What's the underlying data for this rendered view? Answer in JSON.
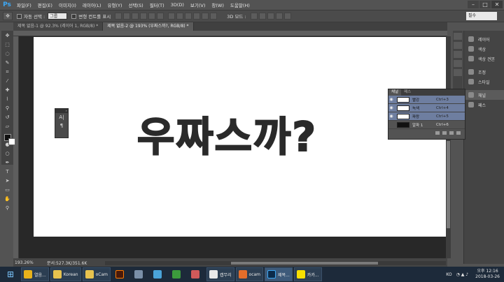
{
  "menu": {
    "logo": "Ps",
    "items": [
      "파일(F)",
      "편집(E)",
      "이미지(I)",
      "레이어(L)",
      "유형(Y)",
      "선택(S)",
      "필터(T)",
      "3D(D)",
      "보기(V)",
      "창(W)",
      "도움말(H)"
    ]
  },
  "window_controls": {
    "minimize": "–",
    "maximize": "□",
    "close": "✕"
  },
  "options": {
    "auto_select_label": "자동 선택 :",
    "auto_select_value": "그룹",
    "transform_label": "변형 컨트롤 표시",
    "mode_3d_label": "3D 모드 :",
    "workspace": "필수"
  },
  "tabs": [
    {
      "label": "제목 없음-1 @ 92.3% (레이어 1, RGB/8) *",
      "close": "×"
    },
    {
      "label": "제목 없음-2 @ 193% (우짜스까?, RGB/8) *",
      "close": "×"
    }
  ],
  "canvas": {
    "text": "우짜스까?"
  },
  "char_panel": {
    "icon1": "A|",
    "icon2": "¶"
  },
  "dock": {
    "items": [
      "레이어",
      "색상",
      "색상 견본",
      "조정",
      "스타일",
      "채널",
      "패스"
    ]
  },
  "channels_panel": {
    "tabs": [
      "채널",
      "패스"
    ],
    "rows": [
      {
        "name": "빨강",
        "shortcut": "Ctrl+3"
      },
      {
        "name": "녹색",
        "shortcut": "Ctrl+4"
      },
      {
        "name": "파랑",
        "shortcut": "Ctrl+5"
      },
      {
        "name": "알파 1",
        "shortcut": "Ctrl+6"
      }
    ]
  },
  "status": {
    "zoom": "193.26%",
    "doc": "문서:527.3K/351.6K"
  },
  "taskbar": {
    "items": [
      "열음...",
      "Korean",
      "oCam",
      "캡쳐",
      "캡무리",
      "ocam",
      "제목...",
      "카카..."
    ],
    "clock_time": "오후 12:16",
    "clock_date": "2018-03-26",
    "lang": "KO"
  },
  "colors": {
    "accent": "#3da8f5",
    "channel_highlight": "#6e7ea0"
  }
}
